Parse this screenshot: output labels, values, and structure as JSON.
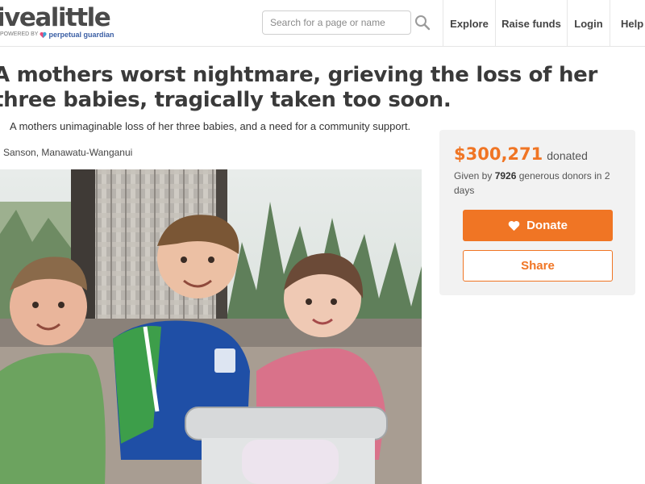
{
  "header": {
    "logo_text": "ivealittle",
    "logo_powered": "POWERED BY",
    "logo_partner": "perpetual guardian",
    "search_placeholder": "Search for a page or name",
    "nav": [
      "Explore",
      "Raise funds",
      "Login",
      "Help"
    ]
  },
  "page": {
    "title": "A mothers worst nightmare, grieving the loss of her three babies, tragically taken too soon.",
    "summary": "A mothers unimaginable loss of her three babies, and a need for a community support.",
    "location": "Sanson, Manawatu-Wanganui"
  },
  "donation": {
    "amount": "$300,271",
    "donated_label": "donated",
    "given_prefix": "Given by ",
    "donor_count": "7926",
    "given_suffix": " generous donors in 2 days",
    "donate_label": "Donate",
    "share_label": "Share"
  },
  "colors": {
    "accent": "#f07524",
    "panel_bg": "#f2f2f2",
    "text_dark": "#3a3a3a"
  },
  "icons": {
    "search": "search-icon",
    "donate": "heart-icon",
    "logo": "heart-logo-icon"
  }
}
